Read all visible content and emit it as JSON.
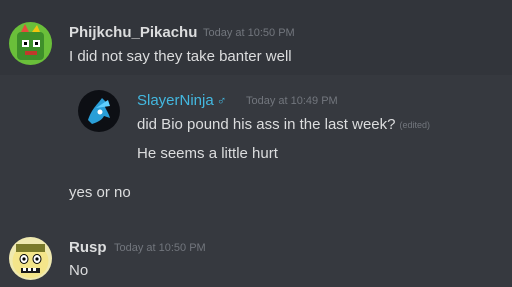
{
  "messages": [
    {
      "author": "Phijkchu_Pikachu",
      "author_color": "#ffffff",
      "timestamp": "Today at 10:50 PM",
      "lines": [
        "I did not say they take banter well"
      ],
      "avatar_icon": "green-character-avatar"
    },
    {
      "author": "SlayerNinja",
      "author_symbol": "♂",
      "author_color": "#43b8e0",
      "timestamp": "Today at 10:49 PM",
      "lines": [
        "did Bio pound his ass in the last week?",
        "He seems a little hurt"
      ],
      "edited_label": "(edited)",
      "avatar_icon": "blue-ninja-avatar",
      "quoted": true
    },
    {
      "author": "",
      "lines": [
        "yes or no"
      ]
    },
    {
      "author": "Rusp",
      "author_color": "#ffffff",
      "timestamp": "Today at 10:50 PM",
      "lines": [
        "No"
      ],
      "avatar_icon": "yellow-face-avatar"
    }
  ],
  "colors": {
    "background": "#36393f",
    "highlight": "#32353b",
    "text": "#dcddde",
    "muted": "#72767d"
  }
}
